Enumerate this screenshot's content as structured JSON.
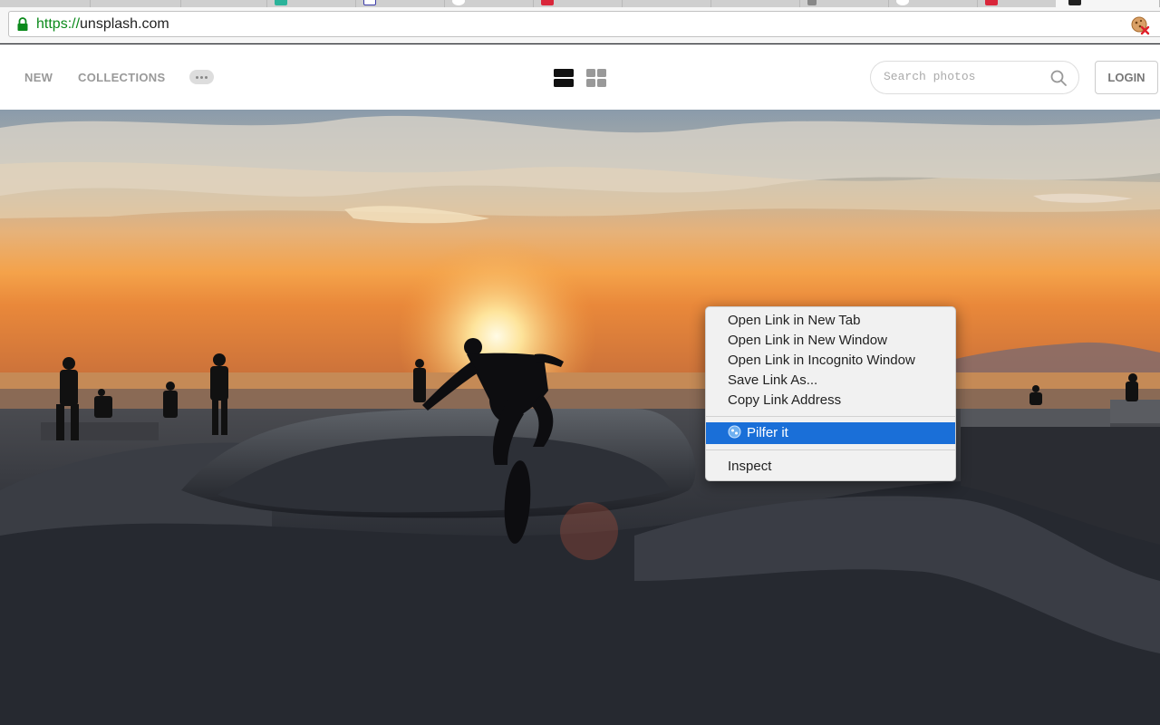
{
  "browser": {
    "url_scheme": "https://",
    "url_host": "unsplash.com"
  },
  "site_nav": {
    "new_label": "NEW",
    "collections_label": "COLLECTIONS",
    "more_icon": "ellipsis-icon",
    "search_placeholder": "Search photos",
    "login_label": "LOGIN"
  },
  "context_menu": {
    "items": [
      {
        "label": "Open Link in New Tab"
      },
      {
        "label": "Open Link in New Window"
      },
      {
        "label": "Open Link in Incognito Window"
      },
      {
        "label": "Save Link As..."
      },
      {
        "label": "Copy Link Address"
      },
      {
        "label": "Pilfer it",
        "selected": true,
        "icon": "pilfer-icon"
      },
      {
        "label": "Inspect"
      }
    ]
  },
  "colors": {
    "url_scheme": "#0b8a1b",
    "menu_highlight": "#1a6fd8",
    "nav_text": "#999999"
  }
}
